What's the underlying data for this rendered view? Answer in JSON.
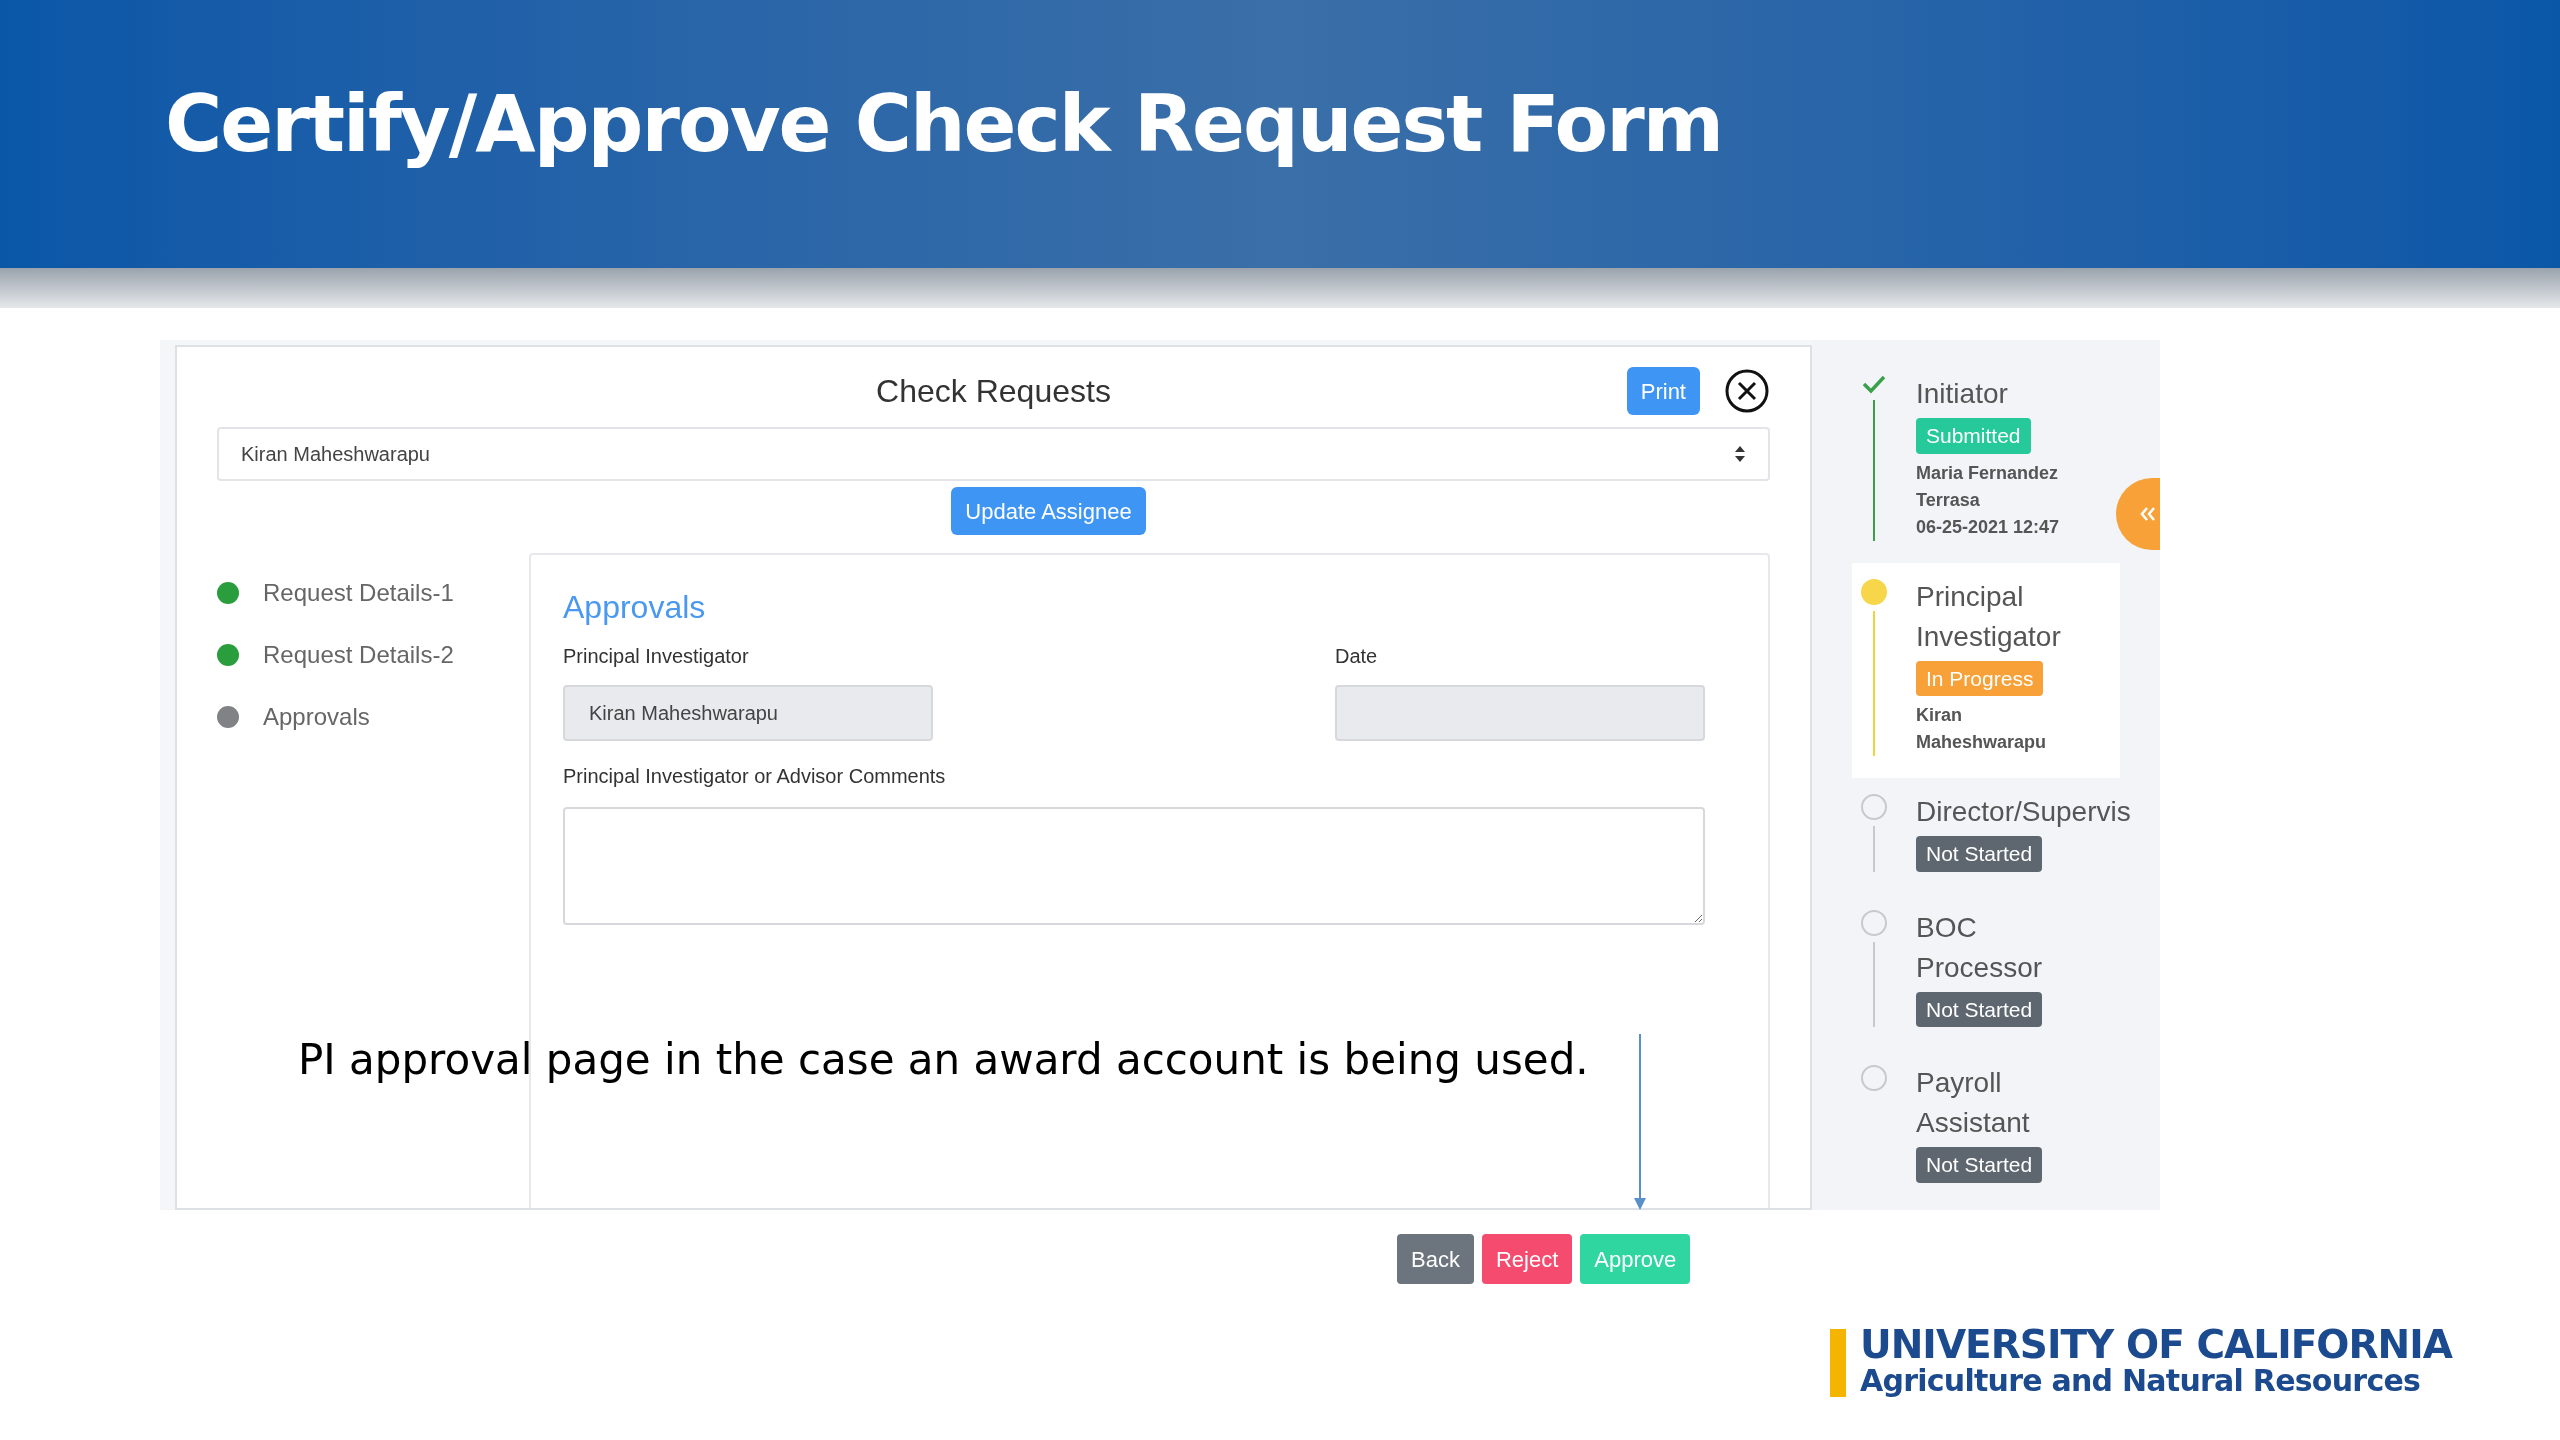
{
  "slide_title": "Certify/Approve Check Request Form",
  "dialog": {
    "title": "Check Requests",
    "print_button": "Print",
    "assignee_select": {
      "value": "Kiran Maheshwarapu"
    },
    "update_button": "Update Assignee"
  },
  "steps_nav": [
    {
      "label": "Request Details-1",
      "completed": true
    },
    {
      "label": "Request Details-2",
      "completed": true
    },
    {
      "label": "Approvals",
      "completed": false
    }
  ],
  "section": {
    "heading": "Approvals",
    "pi_field": {
      "label": "Principal Investigator",
      "value": "Kiran Maheshwarapu"
    },
    "date_field": {
      "label": "Date"
    },
    "comments_field": {
      "label": "Principal Investigator or Advisor Comments"
    }
  },
  "workflow": [
    {
      "role": "Initiator",
      "kind": "done",
      "badge": "Submitted",
      "person": "Maria Fernandez Terrasa",
      "time": "06-25-2021 12:47",
      "highlighted": false
    },
    {
      "role": "Principal Investigator",
      "kind": "current",
      "badge": "In Progress",
      "person": "Kiran Maheshwarapu",
      "highlighted": true
    },
    {
      "role": "Director/Supervis",
      "kind": "pending",
      "badge": "Not Started",
      "highlighted": false
    },
    {
      "role": "BOC Processor",
      "kind": "pending",
      "badge": "Not Started",
      "highlighted": false
    },
    {
      "role": "Payroll Assistant",
      "kind": "pending",
      "badge": "Not Started",
      "highlighted": false
    }
  ],
  "caption": "PI approval page in the case an award account is being used.",
  "actions": [
    {
      "label": "Back",
      "kind": "back"
    },
    {
      "label": "Reject",
      "kind": "reject"
    },
    {
      "label": "Approve",
      "kind": "approve"
    }
  ],
  "logo": {
    "line_1": "UNIVERSITY OF CALIFORNIA",
    "line_2": "Agriculture and Natural Resources"
  }
}
